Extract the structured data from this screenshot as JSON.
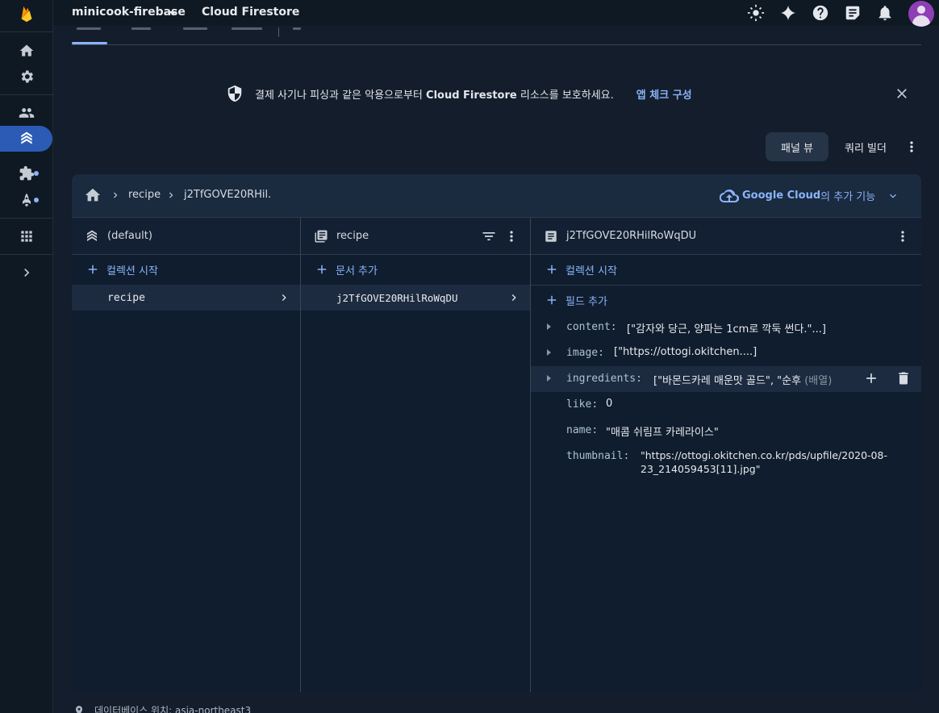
{
  "topbar": {
    "project": "minicook-firebase",
    "product": "Cloud Firestore",
    "icons": [
      "theme-icon",
      "gemini-sparkle-icon",
      "help-icon",
      "feedback-icon",
      "notifications-icon",
      "account-avatar"
    ]
  },
  "sidebar": {
    "items": [
      "home-icon",
      "settings-icon",
      "users-icon",
      "firestore-icon",
      "extensions-icon",
      "launch-icon",
      "apps-grid-icon",
      "expand-icon"
    ]
  },
  "banner": {
    "text_before": "결제 사기나 피싱과 같은 악용으로부터 ",
    "text_bold": "Cloud Firestore",
    "text_after": " 리소스를 보호하세요.",
    "link": "앱 체크 구성"
  },
  "view": {
    "panel_view": "패널 뷰",
    "query_builder": "쿼리 빌더"
  },
  "breadcrumb": {
    "collection": "recipe",
    "document": "j2TfGOVE20RHil."
  },
  "google_cloud": {
    "brand": "Google Cloud",
    "suffix": "의 추가 기능"
  },
  "columns": {
    "database": {
      "title": "(default)",
      "add_label": "컬렉션 시작",
      "items": [
        "recipe"
      ]
    },
    "collection": {
      "title": "recipe",
      "add_label": "문서 추가",
      "items": [
        "j2TfGOVE20RHilRoWqDU"
      ]
    },
    "document": {
      "title": "j2TfGOVE20RHilRoWqDU",
      "add_collection_label": "컬렉션 시작",
      "add_field_label": "필드 추가",
      "fields": [
        {
          "key": "content",
          "value": "[\"감자와 당근, 양파는 1cm로 깍둑 썬다.\"...]"
        },
        {
          "key": "image",
          "value": "[\"https://ottogi.okitchen....]"
        },
        {
          "key": "ingredients",
          "value": "[\"바몬드카레 매운맛 골드\", \"순후",
          "type": "(배열)"
        },
        {
          "key": "like",
          "value": "0"
        },
        {
          "key": "name",
          "value": "\"매콤 쉬림프 카레라이스\""
        },
        {
          "key": "thumbnail",
          "value_line1": "\"https://ottogi.okitchen.co.kr/pds/upfile/2020-08-",
          "value_line2": "23_214059453[11].jpg\""
        }
      ]
    }
  },
  "footer": {
    "text": "데이터베이스 위치: asia-northeast3"
  }
}
